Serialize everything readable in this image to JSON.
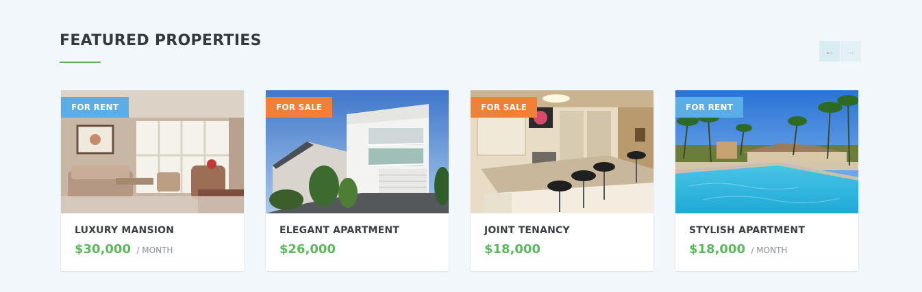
{
  "section": {
    "title": "FEATURED PROPERTIES",
    "accent_color": "#5cb85c",
    "nav": {
      "prev_icon": "←",
      "next_icon": "→"
    }
  },
  "properties": [
    {
      "title": "LUXURY MANSION",
      "status": "FOR RENT",
      "status_color": "#5aade6",
      "price": "$30,000",
      "price_suffix": "/ MONTH",
      "image": "living-room-photo"
    },
    {
      "title": "ELEGANT APARTMENT",
      "status": "FOR SALE",
      "status_color": "#f08036",
      "price": "$26,000",
      "price_suffix": "",
      "image": "modern-house-photo"
    },
    {
      "title": "JOINT TENANCY",
      "status": "FOR SALE",
      "status_color": "#f08036",
      "price": "$18,000",
      "price_suffix": "",
      "image": "kitchen-photo"
    },
    {
      "title": "STYLISH APARTMENT",
      "status": "FOR RENT",
      "status_color": "#5aade6",
      "price": "$18,000",
      "price_suffix": "/ MONTH",
      "image": "pool-photo"
    }
  ]
}
